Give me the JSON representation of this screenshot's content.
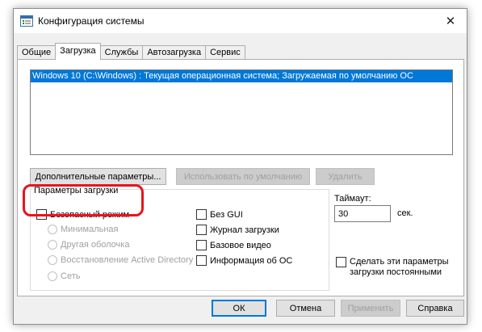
{
  "window": {
    "title": "Конфигурация системы",
    "close_glyph": "✕"
  },
  "tabs": [
    {
      "label": "Общие",
      "active": false
    },
    {
      "label": "Загрузка",
      "active": true
    },
    {
      "label": "Службы",
      "active": false
    },
    {
      "label": "Автозагрузка",
      "active": false
    },
    {
      "label": "Сервис",
      "active": false
    }
  ],
  "os_list": {
    "items": [
      "Windows 10 (C:\\Windows) : Текущая операционная система; Загружаемая по умолчанию ОС"
    ],
    "selected_index": 0
  },
  "boot_buttons": {
    "advanced": "Дополнительные параметры...",
    "set_default": "Использовать по умолчанию",
    "delete": "Удалить"
  },
  "boot_options": {
    "legend": "Параметры загрузки",
    "safe_mode": "Безопасный режим",
    "minimal": "Минимальная",
    "alternate_shell": "Другая оболочка",
    "ad_repair": "Восстановление Active Directory",
    "network": "Сеть",
    "no_gui": "Без GUI",
    "boot_log": "Журнал загрузки",
    "base_video": "Базовое видео",
    "os_info": "Информация  об ОС"
  },
  "timeout": {
    "label": "Таймаут:",
    "value": "30",
    "unit": "сек."
  },
  "persist": {
    "line1": "Сделать эти параметры",
    "line2": "загрузки постоянными"
  },
  "dialog_buttons": {
    "ok": "ОК",
    "cancel": "Отмена",
    "apply": "Применить",
    "help": "Справка"
  },
  "colors": {
    "selection": "#0078d7",
    "highlight_ring": "#e8141e"
  },
  "icons": {
    "app": "msconfig-icon",
    "close": "close-icon"
  }
}
